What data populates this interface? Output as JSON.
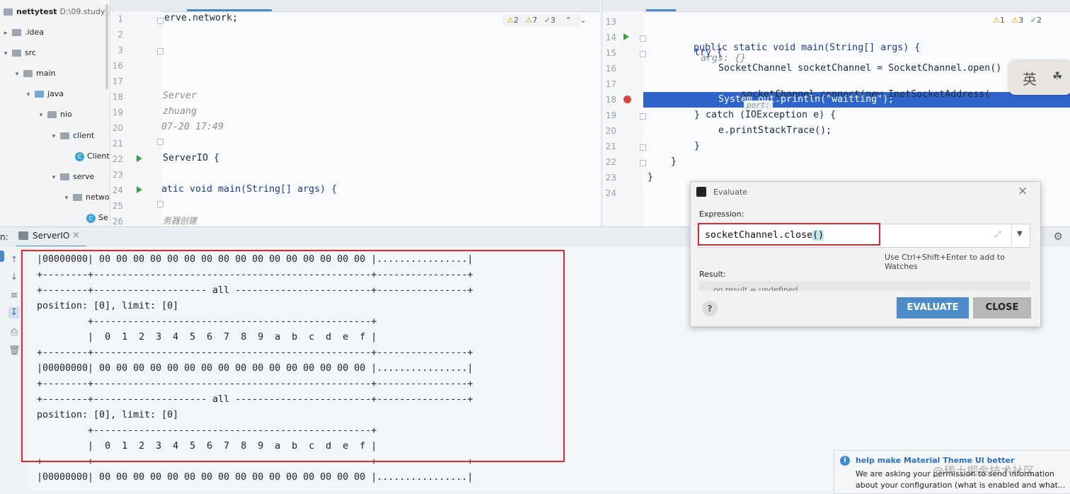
{
  "project": {
    "name": "nettytest",
    "path": "D:\\09.study_pro",
    "items": [
      {
        "label": ".idea"
      },
      {
        "label": "src"
      },
      {
        "label": "main"
      },
      {
        "label": "java"
      },
      {
        "label": "nio"
      },
      {
        "label": "client"
      },
      {
        "label": "Client"
      },
      {
        "label": "serve"
      },
      {
        "label": "netwo"
      },
      {
        "label": "Se"
      }
    ]
  },
  "left_editor": {
    "inspections": {
      "warnings": "2",
      "weak": "7",
      "typos": "3"
    },
    "line_numbers": [
      "1",
      "2",
      "3",
      "16",
      "17",
      "18",
      "19",
      "20",
      "21",
      "22",
      "23",
      "24",
      "25",
      "26"
    ],
    "lines": [
      "erve.network;",
      "Server",
      "zhuang",
      "07-20 17:49",
      "ServerIO {",
      "atic void main(String[] args) {",
      "务器创建"
    ]
  },
  "right_editor": {
    "inspections": {
      "warnings": "1",
      "weak": "3",
      "typos": "2"
    },
    "line_numbers": [
      "13",
      "14",
      "15",
      "16",
      "17",
      "18",
      "19",
      "20",
      "21",
      "22",
      "23",
      "24"
    ],
    "main_sig": "public static void main(String[] args) {",
    "main_hint": "args: {}",
    "try_line": "try {",
    "open_line": "SocketChannel socketChannel = SocketChannel.open()",
    "connect_line": "socketChannel.connect(new InetSocketAddress(",
    "connect_hint": "port:",
    "println_line": "System.out.println(\"waitting\");",
    "catch_line": "} catch (IOException e) {",
    "print_trace_line": "e.printStackTrace();",
    "brace_1": "}",
    "brace_2": "}",
    "brace_3": "}",
    "ime_label": "英"
  },
  "run_panel": {
    "prefix": "n:",
    "tab_label": "ServerIO",
    "close": "×"
  },
  "console_lines": [
    "         +-------------------------------------------------+",
    "|00000000| 00 00 00 00 00 00 00 00 00 00 00 00 00 00 00 00 |................|",
    "+--------+-------------------------------------------------+----------------+",
    "+--------+-------------------- all ------------------------+----------------+",
    "position: [0], limit: [0]",
    "         +-------------------------------------------------+",
    "         |  0  1  2  3  4  5  6  7  8  9  a  b  c  d  e  f |",
    "+--------+-------------------------------------------------+----------------+",
    "|00000000| 00 00 00 00 00 00 00 00 00 00 00 00 00 00 00 00 |................|",
    "+--------+-------------------------------------------------+----------------+",
    "+--------+-------------------- all ------------------------+----------------+",
    "position: [0], limit: [0]",
    "         +-------------------------------------------------+",
    "         |  0  1  2  3  4  5  6  7  8  9  a  b  c  d  e  f |",
    "+--------+-------------------------------------------------+----------------+",
    "|00000000| 00 00 00 00 00 00 00 00 00 00 00 00 00 00 00 00 |................|"
  ],
  "evaluate": {
    "title": "Evaluate",
    "close": "×",
    "expression_label": "Expression:",
    "expression_value": "socketChannel.close",
    "expression_parens": "()",
    "watch_hint": "Use Ctrl+Shift+Enter to add to Watches",
    "result_label": "Result:",
    "result_value": "oo result = undefined",
    "help": "?",
    "evaluate_button": "EVALUATE",
    "close_button": "CLOSE"
  },
  "notification": {
    "title": "help make Material Theme UI better",
    "body_1": "We are asking your permission to send information",
    "body_2": "about your configuration (what is enabled and what...",
    "watermark": "@稀土掘金技术社区"
  }
}
